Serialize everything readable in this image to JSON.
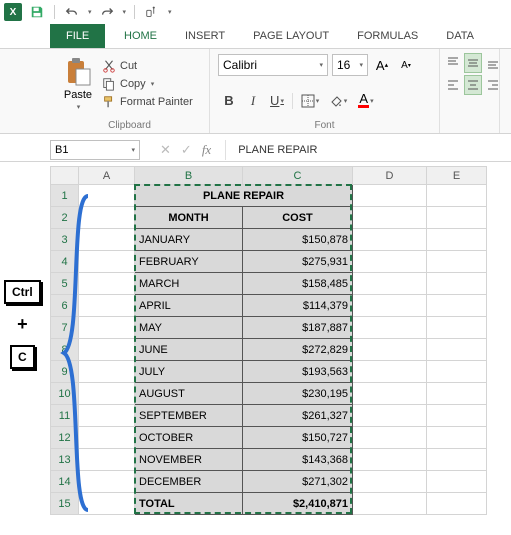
{
  "qat": {
    "app": "X"
  },
  "tabs": {
    "file": "FILE",
    "home": "HOME",
    "insert": "INSERT",
    "pagelayout": "PAGE LAYOUT",
    "formulas": "FORMULAS",
    "data": "DATA"
  },
  "clipboard": {
    "paste": "Paste",
    "cut": "Cut",
    "copy": "Copy",
    "format_painter": "Format Painter",
    "group": "Clipboard"
  },
  "font": {
    "name": "Calibri",
    "size": "16",
    "group": "Font"
  },
  "namebox": "B1",
  "formula_value": "PLANE REPAIR",
  "cols": [
    "A",
    "B",
    "C",
    "D",
    "E"
  ],
  "table": {
    "title": "PLANE REPAIR",
    "h_month": "MONTH",
    "h_cost": "COST",
    "rows": [
      {
        "m": "JANUARY",
        "c": "$150,878"
      },
      {
        "m": "FEBRUARY",
        "c": "$275,931"
      },
      {
        "m": "MARCH",
        "c": "$158,485"
      },
      {
        "m": "APRIL",
        "c": "$114,379"
      },
      {
        "m": "MAY",
        "c": "$187,887"
      },
      {
        "m": "JUNE",
        "c": "$272,829"
      },
      {
        "m": "JULY",
        "c": "$193,563"
      },
      {
        "m": "AUGUST",
        "c": "$230,195"
      },
      {
        "m": "SEPTEMBER",
        "c": "$261,327"
      },
      {
        "m": "OCTOBER",
        "c": "$150,727"
      },
      {
        "m": "NOVEMBER",
        "c": "$143,368"
      },
      {
        "m": "DECEMBER",
        "c": "$271,302"
      }
    ],
    "total_label": "TOTAL",
    "total_value": "$2,410,871"
  },
  "keys": {
    "ctrl": "Ctrl",
    "plus": "+",
    "c": "C"
  }
}
